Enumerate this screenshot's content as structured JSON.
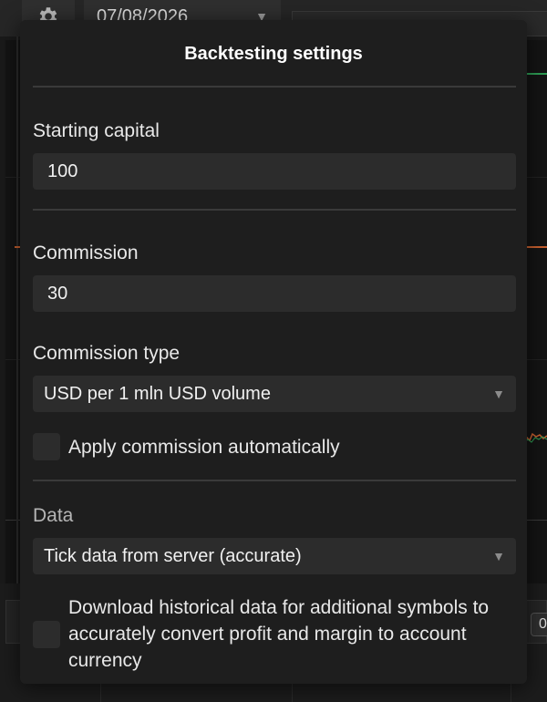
{
  "toolbar": {
    "settings_icon": "gear-icon",
    "date_value": "07/08/2026",
    "mini_button_label": "0"
  },
  "dialog": {
    "title": "Backtesting settings",
    "starting_capital": {
      "label": "Starting capital",
      "value": "100"
    },
    "commission": {
      "label": "Commission",
      "value": "30"
    },
    "commission_type": {
      "label": "Commission type",
      "selected": "USD per 1 mln USD volume"
    },
    "apply_commission": {
      "label": "Apply commission automatically",
      "checked": false
    },
    "data_section": {
      "label": "Data",
      "selected": "Tick data from server (accurate)"
    },
    "download_history": {
      "label": "Download historical data for additional symbols to accurately convert profit and margin to account currency",
      "checked": false
    }
  },
  "colors": {
    "dialog_bg": "#1e1e1e",
    "input_bg": "#2c2c2c",
    "divider": "#3a3a3a",
    "chart_green": "#2e9e55",
    "chart_orange": "#c8602f"
  }
}
